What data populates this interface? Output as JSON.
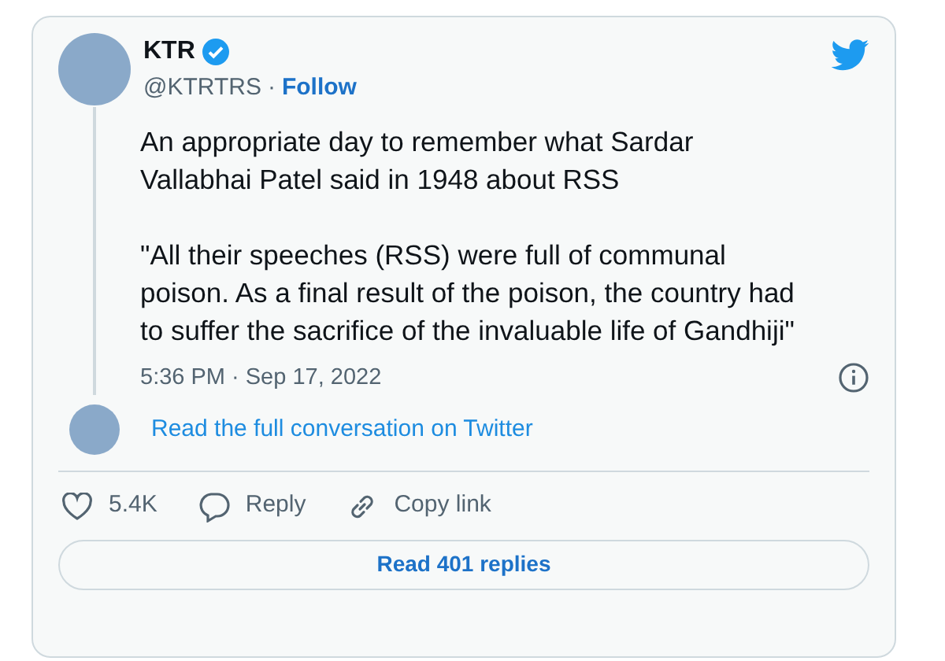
{
  "author": {
    "name": "KTR",
    "verified": true,
    "handle": "@KTRTRS",
    "separator": "·",
    "follow": "Follow"
  },
  "paragraphs": [
    "An appropriate day to remember what Sardar Vallabhai Patel said in 1948 about RSS",
    "\"All their speeches (RSS) were full of communal poison. As a final result of the poison, the country had to suffer the sacrifice of the invaluable life of Gandhiji\""
  ],
  "timestamp": "5:36 PM · Sep 17, 2022",
  "conversation_link": "Read the full conversation on Twitter",
  "actions": [
    {
      "kind": "like",
      "label": "5.4K"
    },
    {
      "kind": "reply",
      "label": "Reply"
    },
    {
      "kind": "link",
      "label": "Copy link"
    }
  ],
  "replies_button": "Read 401 replies"
}
